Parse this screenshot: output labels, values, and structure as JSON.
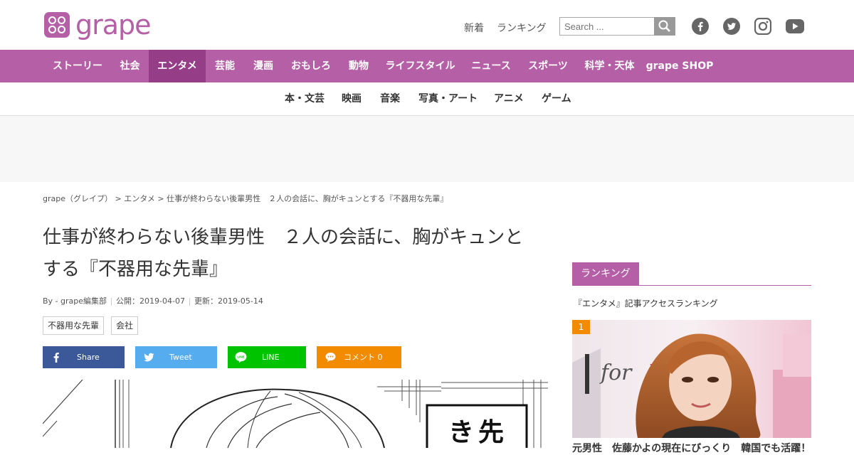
{
  "header": {
    "logo_text": "grape",
    "links": [
      "新着",
      "ランキング"
    ],
    "search_placeholder": "Search ...",
    "social": [
      "facebook-icon",
      "twitter-icon",
      "instagram-icon",
      "youtube-icon"
    ]
  },
  "nav": {
    "items": [
      "ストーリー",
      "社会",
      "エンタメ",
      "芸能",
      "漫画",
      "おもしろ",
      "動物",
      "ライフスタイル",
      "ニュース",
      "スポーツ",
      "科学・天体",
      "grape SHOP"
    ],
    "active": "エンタメ"
  },
  "subnav": {
    "items": [
      "本・文芸",
      "映画",
      "音楽",
      "写真・アート",
      "アニメ",
      "ゲーム"
    ]
  },
  "breadcrumb": "grape（グレイプ）  >  エンタメ  >  仕事が終わらない後輩男性　２人の会話に、胸がキュンとする『不器用な先輩』",
  "article": {
    "title": "仕事が終わらない後輩男性　２人の会話に、胸がキュンとする『不器用な先輩』",
    "author": "By - grape編集部",
    "published": "公開：2019-04-07",
    "updated": "更新：2019-05-14",
    "tags": [
      "不器用な先輩",
      "会社"
    ],
    "share": {
      "facebook": "Share",
      "twitter": "Tweet",
      "line": "LINE",
      "comment": "コメント 0"
    }
  },
  "sidebar": {
    "heading": "ランキング",
    "subheading": "『エンタメ』記事アクセスランキング",
    "rank1_number": "1",
    "rank1_caption": "元男性　佐藤かよの現在にびっくり　韓国でも活躍！"
  },
  "colors": {
    "brand": "#b45fa6",
    "brand_dark": "#963d88",
    "facebook": "#3b5998",
    "twitter": "#55acee",
    "line": "#00c300",
    "comment": "#f28b00"
  }
}
